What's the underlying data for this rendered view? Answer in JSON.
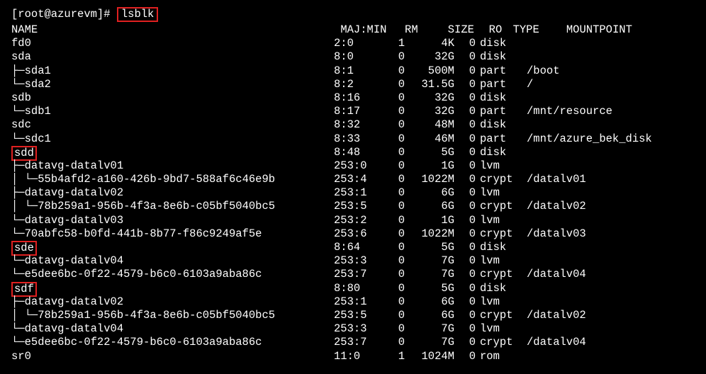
{
  "prompt": {
    "user_host": "[root@azurevm]#",
    "command": "lsblk"
  },
  "columns": {
    "name": "NAME",
    "majmin": "MAJ:MIN",
    "rm": "RM",
    "size": "SIZE",
    "ro": "RO",
    "type": "TYPE",
    "mountpoint": "MOUNTPOINT"
  },
  "rows": [
    {
      "indent": 0,
      "branch": "",
      "name": "fd0",
      "maj": "2:0",
      "rm": "1",
      "size": "4K",
      "ro": "0",
      "type": "disk",
      "mnt": "",
      "hl": false
    },
    {
      "indent": 0,
      "branch": "",
      "name": "sda",
      "maj": "8:0",
      "rm": "0",
      "size": "32G",
      "ro": "0",
      "type": "disk",
      "mnt": "",
      "hl": false
    },
    {
      "indent": 1,
      "branch": "├─",
      "name": "sda1",
      "maj": "8:1",
      "rm": "0",
      "size": "500M",
      "ro": "0",
      "type": "part",
      "mnt": "/boot",
      "hl": false
    },
    {
      "indent": 1,
      "branch": "└─",
      "name": "sda2",
      "maj": "8:2",
      "rm": "0",
      "size": "31.5G",
      "ro": "0",
      "type": "part",
      "mnt": "/",
      "hl": false
    },
    {
      "indent": 0,
      "branch": "",
      "name": "sdb",
      "maj": "8:16",
      "rm": "0",
      "size": "32G",
      "ro": "0",
      "type": "disk",
      "mnt": "",
      "hl": false
    },
    {
      "indent": 1,
      "branch": "└─",
      "name": "sdb1",
      "maj": "8:17",
      "rm": "0",
      "size": "32G",
      "ro": "0",
      "type": "part",
      "mnt": "/mnt/resource",
      "hl": false
    },
    {
      "indent": 0,
      "branch": "",
      "name": "sdc",
      "maj": "8:32",
      "rm": "0",
      "size": "48M",
      "ro": "0",
      "type": "disk",
      "mnt": "",
      "hl": false
    },
    {
      "indent": 1,
      "branch": "└─",
      "name": "sdc1",
      "maj": "8:33",
      "rm": "0",
      "size": "46M",
      "ro": "0",
      "type": "part",
      "mnt": "/mnt/azure_bek_disk",
      "hl": false
    },
    {
      "indent": 0,
      "branch": "",
      "name": "sdd",
      "maj": "8:48",
      "rm": "0",
      "size": "5G",
      "ro": "0",
      "type": "disk",
      "mnt": "",
      "hl": true
    },
    {
      "indent": 1,
      "branch": "├─",
      "name": "datavg-datalv01",
      "maj": "253:0",
      "rm": "0",
      "size": "1G",
      "ro": "0",
      "type": "lvm",
      "mnt": "",
      "hl": false
    },
    {
      "indent": 2,
      "branch": "│ └─",
      "name": "55b4afd2-a160-426b-9bd7-588af6c46e9b",
      "maj": "253:4",
      "rm": "0",
      "size": "1022M",
      "ro": "0",
      "type": "crypt",
      "mnt": "/datalv01",
      "hl": false
    },
    {
      "indent": 1,
      "branch": "├─",
      "name": "datavg-datalv02",
      "maj": "253:1",
      "rm": "0",
      "size": "6G",
      "ro": "0",
      "type": "lvm",
      "mnt": "",
      "hl": false
    },
    {
      "indent": 2,
      "branch": "│ └─",
      "name": "78b259a1-956b-4f3a-8e6b-c05bf5040bc5",
      "maj": "253:5",
      "rm": "0",
      "size": "6G",
      "ro": "0",
      "type": "crypt",
      "mnt": "/datalv02",
      "hl": false
    },
    {
      "indent": 1,
      "branch": "└─",
      "name": "datavg-datalv03",
      "maj": "253:2",
      "rm": "0",
      "size": "1G",
      "ro": "0",
      "type": "lvm",
      "mnt": "",
      "hl": false
    },
    {
      "indent": 2,
      "branch": "  └─",
      "name": "70abfc58-b0fd-441b-8b77-f86c9249af5e",
      "maj": "253:6",
      "rm": "0",
      "size": "1022M",
      "ro": "0",
      "type": "crypt",
      "mnt": "/datalv03",
      "hl": false
    },
    {
      "indent": 0,
      "branch": "",
      "name": "sde",
      "maj": "8:64",
      "rm": "0",
      "size": "5G",
      "ro": "0",
      "type": "disk",
      "mnt": "",
      "hl": true
    },
    {
      "indent": 1,
      "branch": "└─",
      "name": "datavg-datalv04",
      "maj": "253:3",
      "rm": "0",
      "size": "7G",
      "ro": "0",
      "type": "lvm",
      "mnt": "",
      "hl": false
    },
    {
      "indent": 2,
      "branch": "  └─",
      "name": "e5dee6bc-0f22-4579-b6c0-6103a9aba86c",
      "maj": "253:7",
      "rm": "0",
      "size": "7G",
      "ro": "0",
      "type": "crypt",
      "mnt": "/datalv04",
      "hl": false
    },
    {
      "indent": 0,
      "branch": "",
      "name": "sdf",
      "maj": "8:80",
      "rm": "0",
      "size": "5G",
      "ro": "0",
      "type": "disk",
      "mnt": "",
      "hl": true
    },
    {
      "indent": 1,
      "branch": "├─",
      "name": "datavg-datalv02",
      "maj": "253:1",
      "rm": "0",
      "size": "6G",
      "ro": "0",
      "type": "lvm",
      "mnt": "",
      "hl": false
    },
    {
      "indent": 2,
      "branch": "│ └─",
      "name": "78b259a1-956b-4f3a-8e6b-c05bf5040bc5",
      "maj": "253:5",
      "rm": "0",
      "size": "6G",
      "ro": "0",
      "type": "crypt",
      "mnt": "/datalv02",
      "hl": false
    },
    {
      "indent": 1,
      "branch": "└─",
      "name": "datavg-datalv04",
      "maj": "253:3",
      "rm": "0",
      "size": "7G",
      "ro": "0",
      "type": "lvm",
      "mnt": "",
      "hl": false
    },
    {
      "indent": 2,
      "branch": "  └─",
      "name": "e5dee6bc-0f22-4579-b6c0-6103a9aba86c",
      "maj": "253:7",
      "rm": "0",
      "size": "7G",
      "ro": "0",
      "type": "crypt",
      "mnt": "/datalv04",
      "hl": false
    },
    {
      "indent": 0,
      "branch": "",
      "name": "sr0",
      "maj": "11:0",
      "rm": "1",
      "size": "1024M",
      "ro": "0",
      "type": "rom",
      "mnt": "",
      "hl": false
    }
  ]
}
